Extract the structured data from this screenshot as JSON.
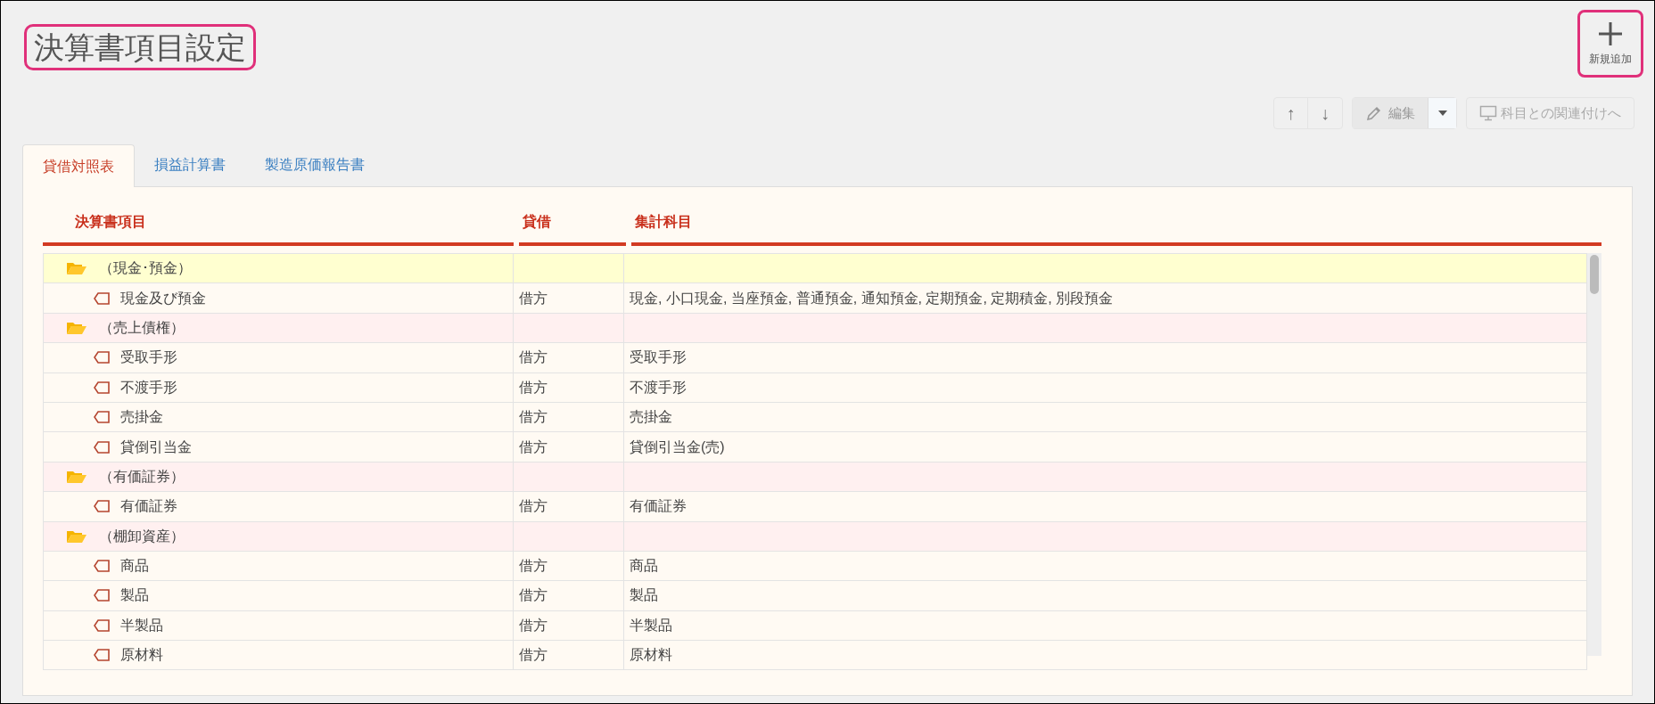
{
  "page": {
    "title": "決算書項目設定"
  },
  "add_button": {
    "label": "新規追加"
  },
  "toolbar": {
    "up": "↑",
    "down": "↓",
    "edit": "編集",
    "link": "科目との関連付けへ"
  },
  "tabs": [
    {
      "label": "貸借対照表",
      "selected": true
    },
    {
      "label": "損益計算書",
      "selected": false
    },
    {
      "label": "製造原価報告書",
      "selected": false
    }
  ],
  "table": {
    "columns": [
      "決算書項目",
      "貸借",
      "集計科目"
    ],
    "rows": [
      {
        "label": "（現金･預金）",
        "selected": true,
        "expanded": true,
        "children": [
          {
            "label": "現金及び預金",
            "side": "借方",
            "accounts": "現金, 小口現金, 当座預金, 普通預金, 通知預金, 定期預金, 定期積金, 別段預金"
          }
        ]
      },
      {
        "label": "（売上債権）",
        "selected": false,
        "expanded": true,
        "children": [
          {
            "label": "受取手形",
            "side": "借方",
            "accounts": "受取手形"
          },
          {
            "label": "不渡手形",
            "side": "借方",
            "accounts": "不渡手形"
          },
          {
            "label": "売掛金",
            "side": "借方",
            "accounts": "売掛金"
          },
          {
            "label": "貸倒引当金",
            "side": "借方",
            "accounts": "貸倒引当金(売)"
          }
        ]
      },
      {
        "label": "（有価証券）",
        "selected": false,
        "expanded": true,
        "children": [
          {
            "label": "有価証券",
            "side": "借方",
            "accounts": "有価証券"
          }
        ]
      },
      {
        "label": "（棚卸資産）",
        "selected": false,
        "expanded": true,
        "children": [
          {
            "label": "商品",
            "side": "借方",
            "accounts": "商品"
          },
          {
            "label": "製品",
            "side": "借方",
            "accounts": "製品"
          },
          {
            "label": "半製品",
            "side": "借方",
            "accounts": "半製品"
          },
          {
            "label": "原材料",
            "side": "借方",
            "accounts": "原材料"
          }
        ]
      }
    ]
  }
}
